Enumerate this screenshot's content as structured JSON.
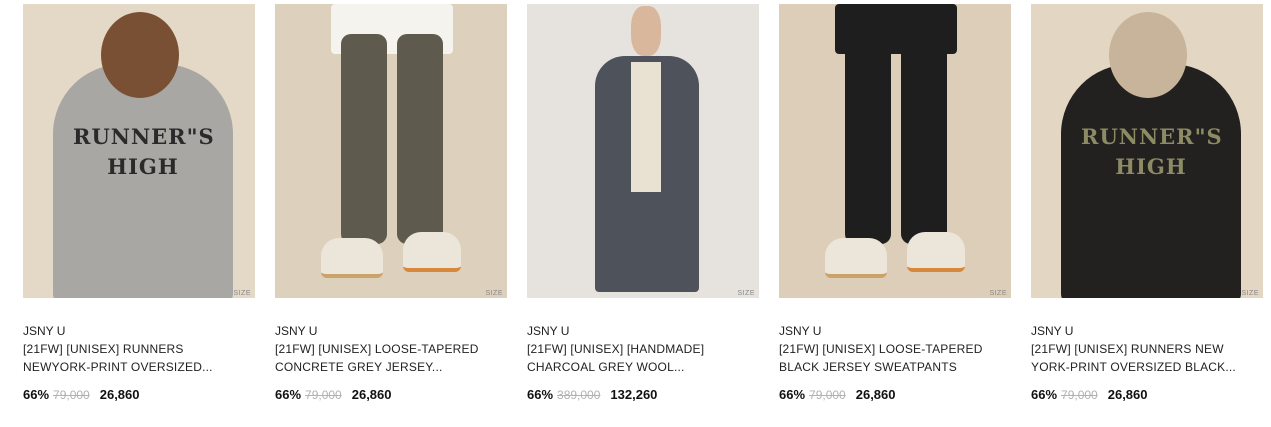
{
  "products": [
    {
      "brand": "JSNY U",
      "title_line1": "[21FW] [UNISEX] RUNNERS",
      "title_line2": "NEWYORK-PRINT OVERSIZED...",
      "discount": "66%",
      "original_price": "79,000",
      "sale_price": "26,860",
      "size_label": "SIZE",
      "print_line1": "RUNNER\"S",
      "print_line2": "HIGH",
      "thumb_color": "#e4d8c6"
    },
    {
      "brand": "JSNY U",
      "title_line1": "[21FW] [UNISEX] LOOSE-TAPERED",
      "title_line2": "CONCRETE GREY JERSEY...",
      "discount": "66%",
      "original_price": "79,000",
      "sale_price": "26,860",
      "size_label": "SIZE",
      "thumb_color": "#ddd0bd"
    },
    {
      "brand": "JSNY U",
      "title_line1": "[21FW] [UNISEX] [HANDMADE]",
      "title_line2": "CHARCOAL GREY WOOL...",
      "discount": "66%",
      "original_price": "389,000",
      "sale_price": "132,260",
      "size_label": "SIZE",
      "thumb_color": "#e6e3df"
    },
    {
      "brand": "JSNY U",
      "title_line1": "[21FW] [UNISEX] LOOSE-TAPERED",
      "title_line2": "BLACK JERSEY SWEATPANTS",
      "discount": "66%",
      "original_price": "79,000",
      "sale_price": "26,860",
      "size_label": "SIZE",
      "thumb_color": "#ddceb9"
    },
    {
      "brand": "JSNY U",
      "title_line1": "[21FW] [UNISEX] RUNNERS NEW",
      "title_line2": "YORK-PRINT OVERSIZED BLACK...",
      "discount": "66%",
      "original_price": "79,000",
      "sale_price": "26,860",
      "size_label": "SIZE",
      "print_line1": "RUNNER\"S",
      "print_line2": "HIGH",
      "thumb_color": "#e3d6c3"
    }
  ]
}
